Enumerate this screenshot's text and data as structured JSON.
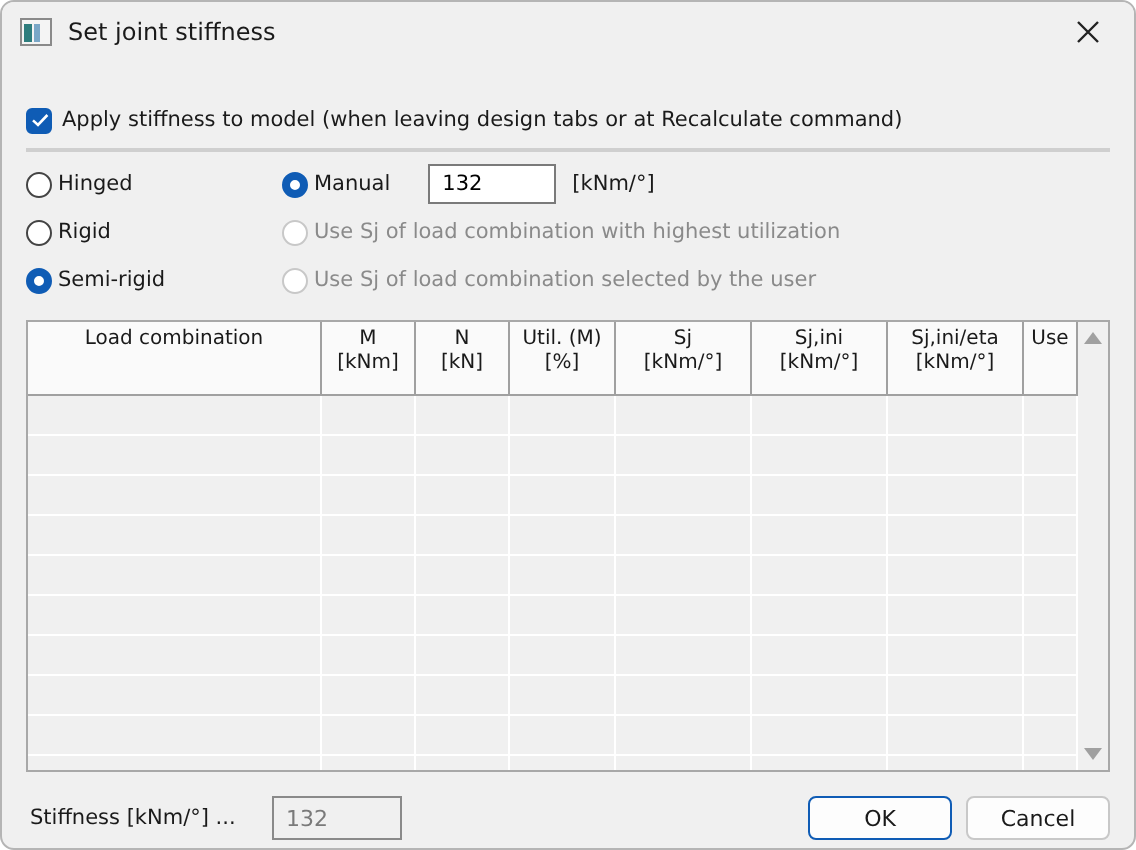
{
  "window": {
    "title": "Set joint stiffness"
  },
  "apply": {
    "label": "Apply stiffness to model (when leaving design tabs or at Recalculate command)",
    "checked": true
  },
  "joint_types": [
    {
      "label": "Hinged",
      "selected": false
    },
    {
      "label": "Rigid",
      "selected": false
    },
    {
      "label": "Semi-rigid",
      "selected": true
    }
  ],
  "stiffness_sources": [
    {
      "label": "Manual",
      "selected": true,
      "disabled": false,
      "value": "132",
      "unit": "[kNm/°]"
    },
    {
      "label": "Use Sj of load combination with highest utilization",
      "selected": false,
      "disabled": true
    },
    {
      "label": "Use Sj of load combination selected by the user",
      "selected": false,
      "disabled": true
    }
  ],
  "table": {
    "columns": [
      {
        "title": "Load combination"
      },
      {
        "title": "M",
        "unit": "[kNm]"
      },
      {
        "title": "N",
        "unit": "[kN]"
      },
      {
        "title": "Util. (M)",
        "unit": "[%]"
      },
      {
        "title": "Sj",
        "unit": "[kNm/°]"
      },
      {
        "title": "Sj,ini",
        "unit": "[kNm/°]"
      },
      {
        "title": "Sj,ini/eta",
        "unit": "[kNm/°]"
      },
      {
        "title": "Use"
      }
    ]
  },
  "footer": {
    "label": "Stiffness [kNm/°] ...",
    "value": "132",
    "disabled": true
  },
  "buttons": [
    {
      "label": "OK",
      "default": true
    },
    {
      "label": "Cancel",
      "default": false
    }
  ]
}
